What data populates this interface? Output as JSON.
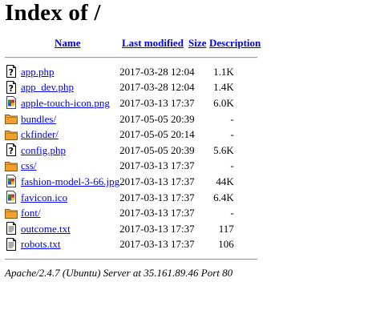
{
  "page": {
    "title": "Index of /"
  },
  "columns": {
    "name": "Name",
    "last_modified": "Last modified",
    "size": "Size",
    "description": "Description"
  },
  "files": [
    {
      "name": "app.php",
      "date": "2017-03-28 12:04",
      "size": "1.1K",
      "icon": "unknown-file-icon"
    },
    {
      "name": "app_dev.php",
      "date": "2017-03-28 12:04",
      "size": "1.4K",
      "icon": "unknown-file-icon"
    },
    {
      "name": "apple-touch-icon.png",
      "date": "2017-03-13 17:37",
      "size": "6.0K",
      "icon": "image-file-icon"
    },
    {
      "name": "bundles/",
      "date": "2017-05-05 20:39",
      "size": "-",
      "icon": "folder-icon"
    },
    {
      "name": "ckfinder/",
      "date": "2017-05-05 20:14",
      "size": "-",
      "icon": "folder-icon"
    },
    {
      "name": "config.php",
      "date": "2017-05-05 20:39",
      "size": "5.6K",
      "icon": "unknown-file-icon"
    },
    {
      "name": "css/",
      "date": "2017-03-13 17:37",
      "size": "-",
      "icon": "folder-icon"
    },
    {
      "name": "fashion-model-3-66.jpg",
      "date": "2017-03-13 17:37",
      "size": "44K",
      "icon": "image-file-icon"
    },
    {
      "name": "favicon.ico",
      "date": "2017-03-13 17:37",
      "size": "6.4K",
      "icon": "image-file-icon"
    },
    {
      "name": "font/",
      "date": "2017-03-13 17:37",
      "size": "-",
      "icon": "folder-icon"
    },
    {
      "name": "outcome.txt",
      "date": "2017-03-13 17:37",
      "size": "117",
      "icon": "text-file-icon"
    },
    {
      "name": "robots.txt",
      "date": "2017-03-13 17:37",
      "size": "106",
      "icon": "text-file-icon"
    }
  ],
  "footer": {
    "server": "Apache/2.4.7 (Ubuntu) Server at 35.161.89.46 Port 80"
  }
}
